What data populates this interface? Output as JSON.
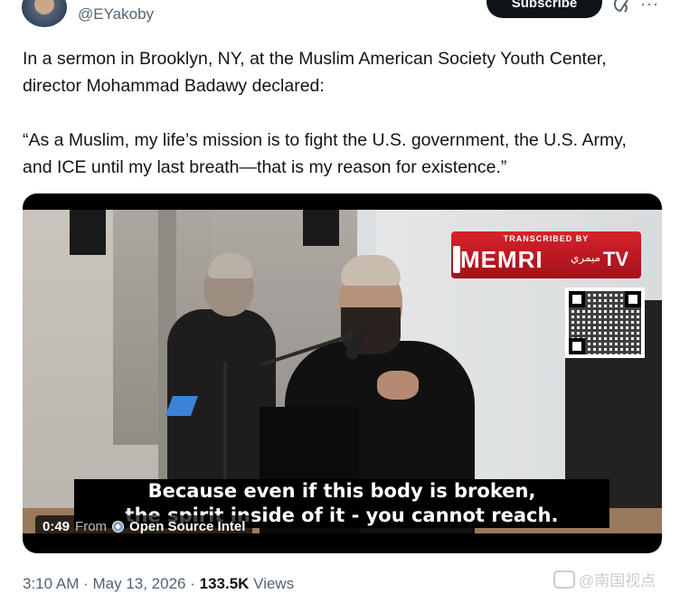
{
  "author": {
    "handle": "@EYakoby"
  },
  "header": {
    "subscribe_label": "Subscribe",
    "more_glyph": "···"
  },
  "tweet": {
    "paragraph_1": "In a sermon in Brooklyn, NY, at the Muslim American Society Youth Center, director Mohammad Badawy declared:",
    "paragraph_2": "“As a Muslim, my life’s mission is to fight the U.S. government, the U.S. Army, and ICE until my last breath—that is my reason for existence.”"
  },
  "video": {
    "logo_top": "TRANSCRIBED BY",
    "logo_main": "MEMRI",
    "logo_arabic": "ميمري",
    "logo_tv": "TV",
    "caption_line_1": "Because even if this body is broken,",
    "caption_line_2": "the spirit inside of it - you cannot reach.",
    "duration": "0:49",
    "from_label": "From",
    "source_name": "Open Source Intel"
  },
  "meta": {
    "time": "3:10 AM",
    "separator": " · ",
    "date": "May 13, 2026",
    "views_count": "133.5K",
    "views_label": " Views"
  },
  "watermark": {
    "text": "@南国视点"
  },
  "colors": {
    "text_primary": "#0f1419",
    "text_secondary": "#536471",
    "memri_red": "#c81d25"
  }
}
